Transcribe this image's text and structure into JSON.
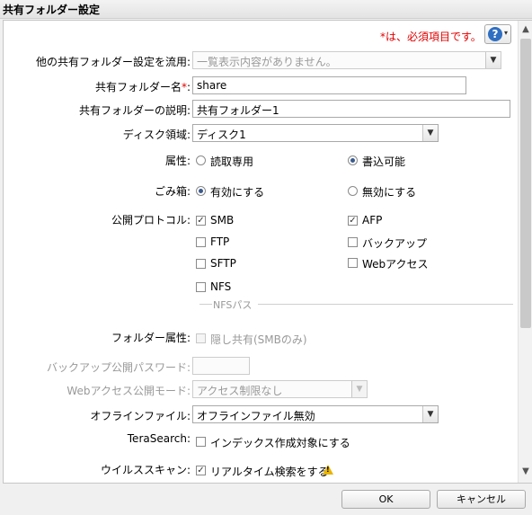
{
  "window": {
    "title": "共有フォルダー設定"
  },
  "required_note": {
    "mark": "*",
    "text": "は、必須項目です。"
  },
  "help": {
    "icon": "question-icon",
    "caret": "▾"
  },
  "form": {
    "apply_other": {
      "label": "他の共有フォルダー設定を流用:",
      "value": "一覧表示内容がありません。"
    },
    "folder_name": {
      "label": "共有フォルダー名",
      "required": "*",
      "colon": ":",
      "value": "share"
    },
    "description": {
      "label": "共有フォルダーの説明:",
      "value": "共有フォルダー1"
    },
    "disk_area": {
      "label": "ディスク領域:",
      "value": "ディスク1"
    },
    "attribute": {
      "label": "属性:",
      "options": [
        "読取専用",
        "書込可能"
      ],
      "selected": 1
    },
    "recycle_bin": {
      "label": "ごみ箱:",
      "options": [
        "有効にする",
        "無効にする"
      ],
      "selected": 0
    },
    "protocols": {
      "label": "公開プロトコル:",
      "items": [
        {
          "label": "SMB",
          "checked": true
        },
        {
          "label": "AFP",
          "checked": true
        },
        {
          "label": "FTP",
          "checked": false
        },
        {
          "label": "バックアップ",
          "checked": false
        },
        {
          "label": "SFTP",
          "checked": false
        },
        {
          "label": "Webアクセス",
          "checked": false
        },
        {
          "label": "NFS",
          "checked": false
        }
      ]
    },
    "nfs_path": {
      "label": "NFSパス"
    },
    "folder_attribute": {
      "label": "フォルダー属性:",
      "option": "隠し共有(SMBのみ)",
      "checked": false
    },
    "backup_password": {
      "label": "バックアップ公開パスワード:",
      "value": ""
    },
    "web_access_mode": {
      "label": "Webアクセス公開モード:",
      "value": "アクセス制限なし"
    },
    "offline_files": {
      "label": "オフラインファイル:",
      "value": "オフラインファイル無効"
    },
    "terasearch": {
      "label": "TeraSearch:",
      "option": "インデックス作成対象にする",
      "checked": false
    },
    "virus_scan": {
      "label": "ウイルススキャン:",
      "option": "リアルタイム検索をする",
      "checked": true,
      "icon": "warning-icon"
    }
  },
  "footer": {
    "ok_label": "OK",
    "cancel_label": "キャンセル"
  },
  "colors": {
    "required": "#e00000",
    "help_icon": "#2f6fc2",
    "warning": "#e8b400"
  }
}
